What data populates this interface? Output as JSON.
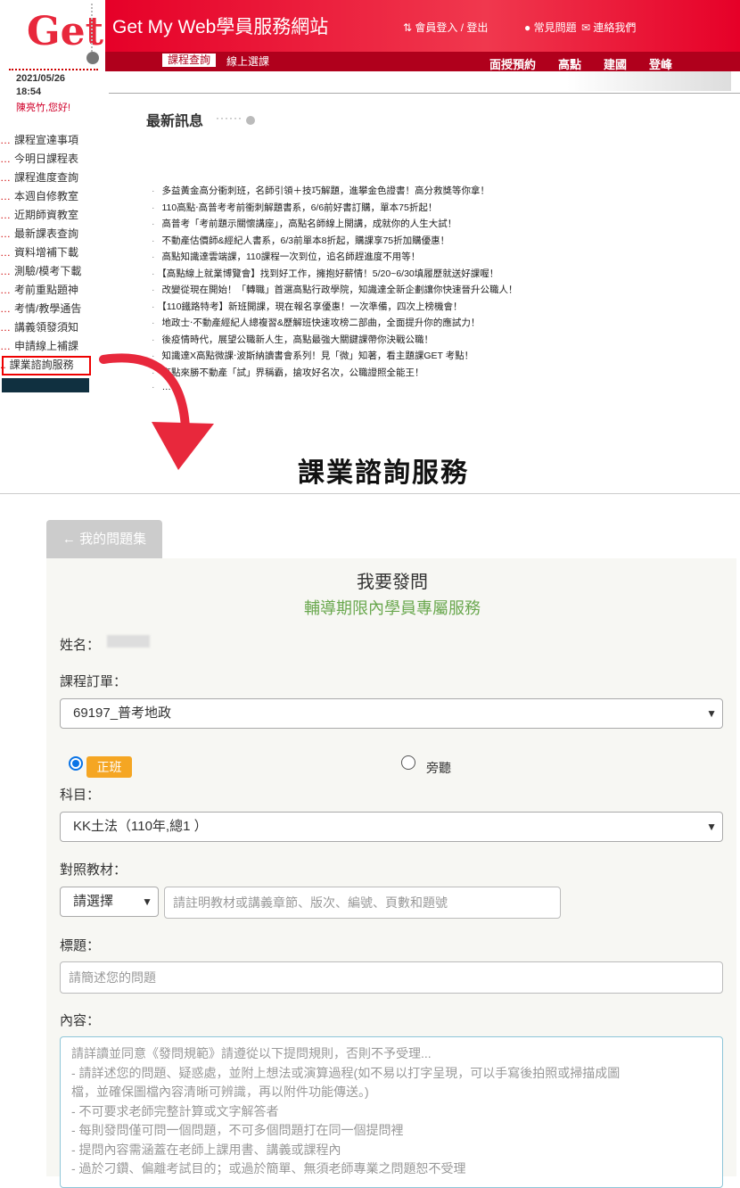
{
  "header": {
    "logo_text": "Get",
    "site_title": "Get My Web學員服務網站",
    "top_links": [
      "會員登入 / 登出",
      "常見問題",
      "連絡我們"
    ],
    "tabs": [
      "課程查詢",
      "線上選課"
    ],
    "right_nav": [
      "面授預約",
      "高點",
      "建國",
      "登峰"
    ]
  },
  "user": {
    "date": "2021/05/26",
    "time": "18:54",
    "greeting": "陳亮竹,您好!"
  },
  "sidebar": {
    "items": [
      "課程宣達事項",
      "今明日課程表",
      "課程進度查詢",
      "本週自修教室",
      "近期師資教室",
      "最新課表查詢",
      "資料增補下載",
      "測驗/模考下載",
      "考前重點題神",
      "考情/教學通告",
      "講義領發須知",
      "申請線上補課",
      "課業諮詢服務"
    ],
    "highlighted": "課業諮詢服務"
  },
  "news": {
    "title": "最新訊息",
    "items": [
      "多益黃金高分衝刺班，名師引領＋技巧解題，進攀金色證書！高分救獎等你拿！",
      "110高點‧高普考考前衝刺解題書系，6/6前好書訂購，單本75折起！",
      "高普考「考前題示關懷講座」，高點名師線上開講，成就你的人生大試！",
      "不動產估價師&經紀人書系，6/3前單本8折起，購課享75折加購優惠！",
      "高點知識達雲端課，110課程一次到位，追名師趕進度不用等！",
      "【高點線上就業博覽會】找到好工作，擁抱好薪情！5/20~6/30填履歷就送好課喔！",
      "改變從現在開始！「轉職」首選高點行政學院，知識達全新企劃讓你快速晉升公職人！",
      "【110鐵路特考】新班開課，現在報名享優惠！一次準備，四次上榜機會！",
      "地政士‧不動產經紀人總複習&歷解班快速攻榜二部曲，全面提升你的應試力！",
      "後疫情時代，展望公職新人生，高點最強大關鍵課帶你決戰公職！",
      "知識達X高點微課‧波斯納讀書會系列！見「微」知著，看主題課GET 考點！",
      "高點來勝不動產「試」界稱霸，搶攻好名次，公職證照全能王！",
      "…"
    ]
  },
  "page_heading": "課業諮詢服務",
  "form": {
    "back_button": "← 我的問題集",
    "title": "我要發問",
    "subtitle": "輔導期限內學員專屬服務",
    "name_label": "姓名：",
    "order_label": "課程訂單：",
    "order_value": "69197_普考地政",
    "radio_regular": "正班",
    "radio_audit": "旁聽",
    "subject_label": "科目：",
    "subject_value": "KK土法（110年,總1 ）",
    "material_label": "對照教材：",
    "material_select": "請選擇",
    "material_placeholder": "請註明教材或講義章節、版次、編號、頁數和題號",
    "title_label": "標題：",
    "title_placeholder": "請簡述您的問題",
    "content_label": "內容：",
    "content_placeholder_lines": [
      "請詳讀並同意《發問規範》請遵從以下提問規則，否則不予受理...",
      "- 請詳述您的問題、疑惑處，並附上想法或演算過程(如不易以打字呈現，可以手寫後拍照或掃描成圖",
      "檔，並確保圖檔內容清晰可辨識，再以附件功能傳送。)",
      "- 不可要求老師完整計算或文字解答者",
      "- 每則發問僅可問一個問題，不可多個問題打在同一個提問裡",
      "- 提問內容需涵蓋在老師上課用書、講義或課程內",
      "- 過於刁鑽、偏離考試目的；或過於簡單、無須老師專業之問題恕不受理"
    ]
  },
  "colors": {
    "brand_red": "#e60028",
    "accent_green": "#6aa84f",
    "badge_orange": "#f5a623",
    "radio_blue": "#0a74e6"
  }
}
